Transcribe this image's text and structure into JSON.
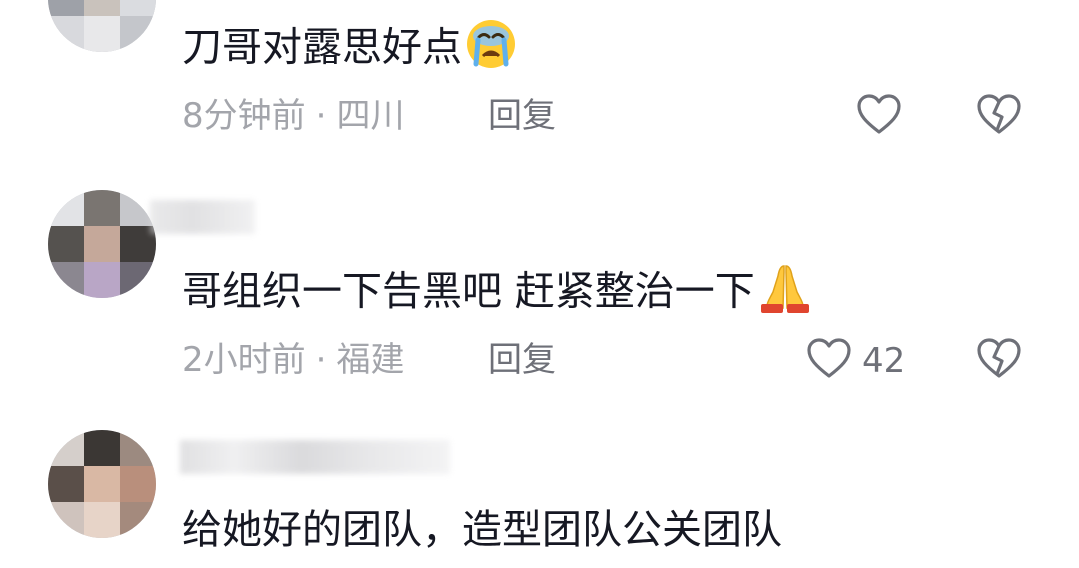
{
  "comments": [
    {
      "text": "刀哥对露思好点",
      "emoji_icon": "loudly-crying-face-emoji",
      "time": "8分钟前",
      "separator": "·",
      "location": "四川",
      "reply_label": "回复",
      "like_count": ""
    },
    {
      "text": "哥组织一下告黑吧 赶紧整治一下",
      "emoji_icon": "folded-hands-emoji",
      "time": "2小时前",
      "separator": "·",
      "location": "福建",
      "reply_label": "回复",
      "like_count": "42"
    },
    {
      "text": "给她好的团队，造型团队公关团队"
    }
  ],
  "colors": {
    "text": "#161823",
    "meta": "#a3a5ab",
    "action": "#6e7078"
  }
}
